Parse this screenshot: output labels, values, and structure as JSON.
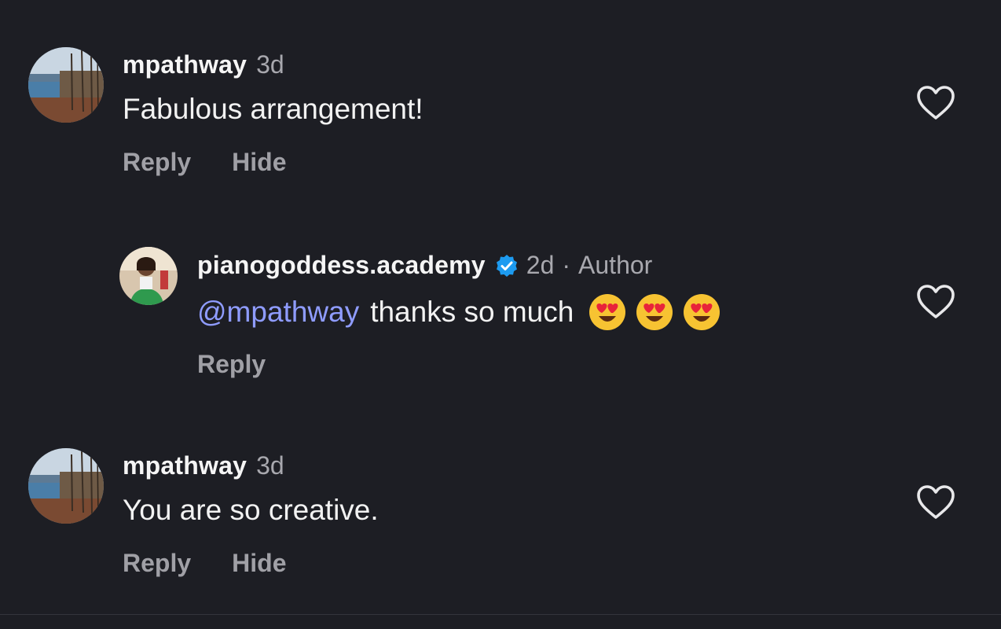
{
  "comments": [
    {
      "username": "mpathway",
      "time": "3d",
      "text": "Fabulous arrangement!",
      "reply_label": "Reply",
      "hide_label": "Hide"
    },
    {
      "username": "pianogoddess.academy",
      "verified": true,
      "time": "2d",
      "separator": "·",
      "author_label": "Author",
      "mention": "@mpathway",
      "text": "thanks so much",
      "emojis": [
        "heart-eyes-emoji",
        "heart-eyes-emoji",
        "heart-eyes-emoji"
      ],
      "reply_label": "Reply"
    },
    {
      "username": "mpathway",
      "time": "3d",
      "text": "You are so creative.",
      "reply_label": "Reply",
      "hide_label": "Hide"
    }
  ],
  "colors": {
    "background": "#1d1e24",
    "mention": "#8f9cff",
    "verified": "#1d9bf0",
    "muted": "#a8a8ae"
  }
}
